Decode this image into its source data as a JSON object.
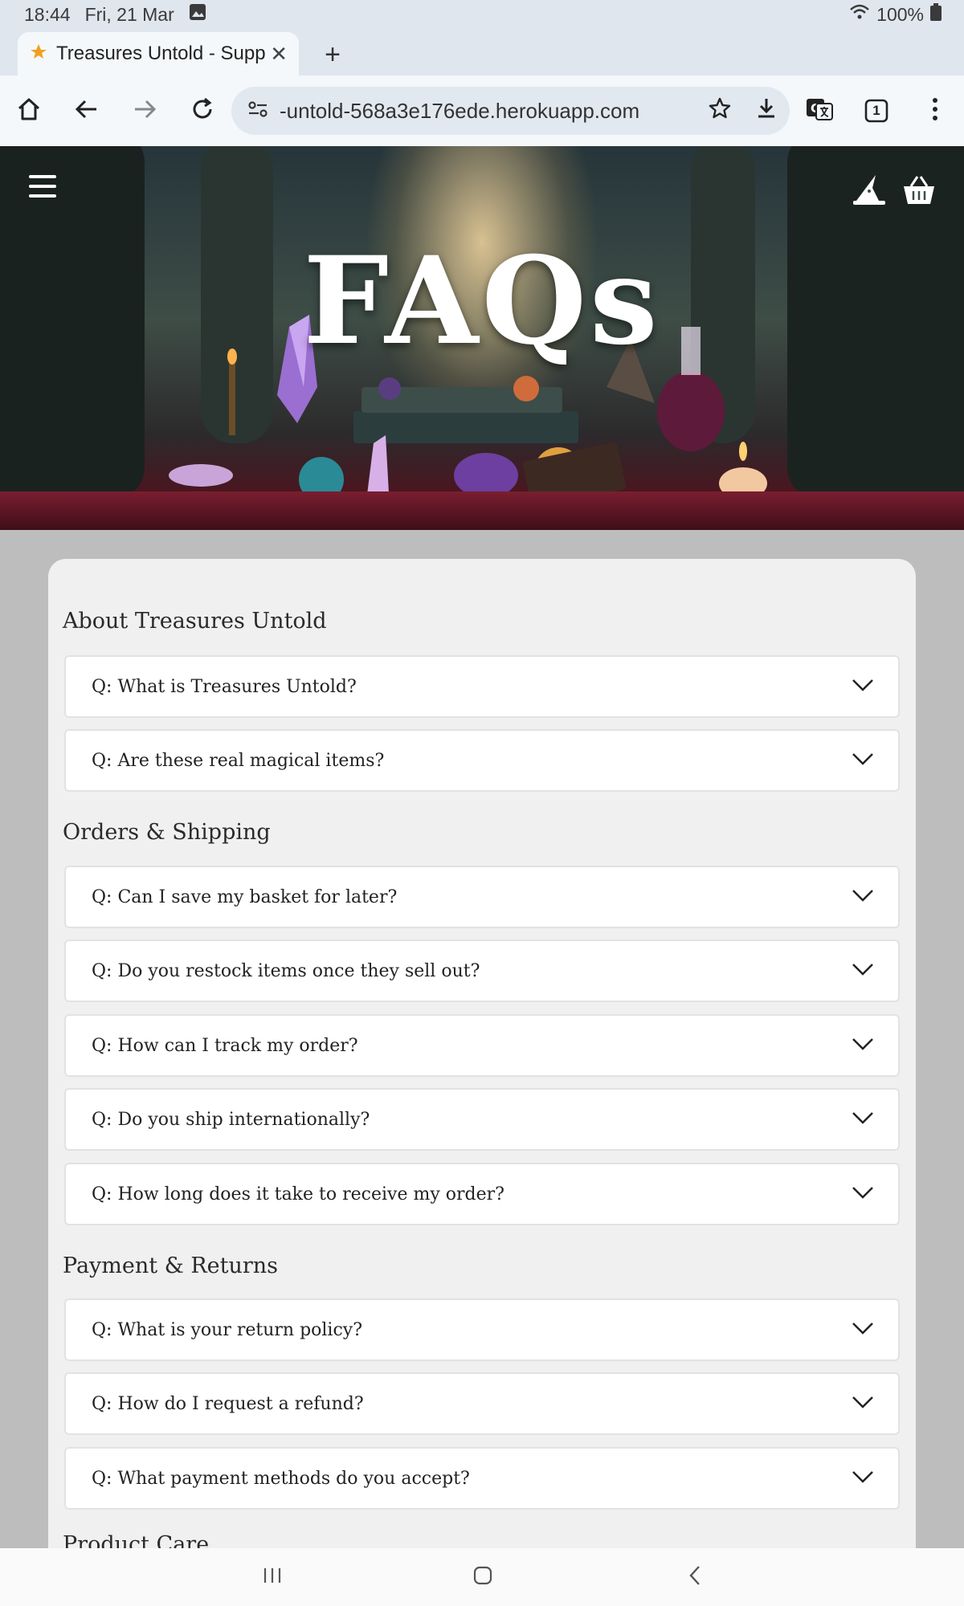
{
  "status": {
    "time": "18:44",
    "date": "Fri, 21 Mar",
    "battery": "100%"
  },
  "browser": {
    "tab_title": "Treasures Untold - Supp",
    "url": "-untold-568a3e176ede.herokuapp.com",
    "tab_count": "1"
  },
  "hero": {
    "title": "FAQs"
  },
  "sections": [
    {
      "title": "About Treasures Untold",
      "items": [
        "Q: What is Treasures Untold?",
        "Q: Are these real magical items?"
      ]
    },
    {
      "title": "Orders & Shipping",
      "items": [
        "Q: Can I save my basket for later?",
        "Q: Do you restock items once they sell out?",
        "Q: How can I track my order?",
        "Q: Do you ship internationally?",
        "Q: How long does it take to receive my order?"
      ]
    },
    {
      "title": "Payment & Returns",
      "items": [
        "Q: What is your return policy?",
        "Q: How do I request a refund?",
        "Q: What payment methods do you accept?"
      ]
    },
    {
      "title": "Product Care",
      "items": []
    }
  ]
}
